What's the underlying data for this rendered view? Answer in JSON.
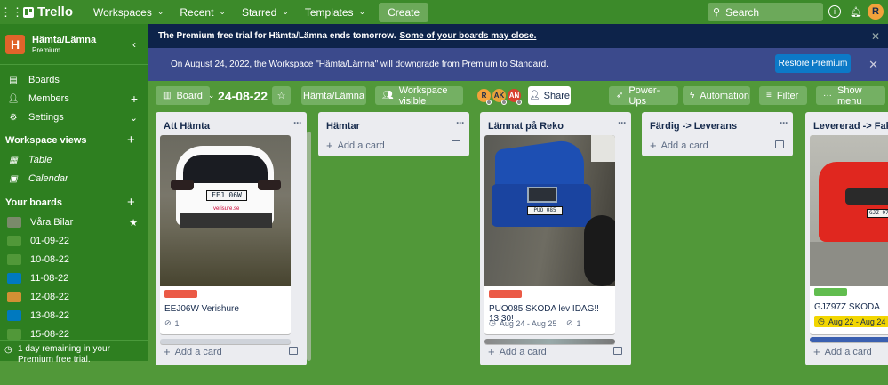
{
  "topbar": {
    "brand": "Trello",
    "menus": [
      "Workspaces",
      "Recent",
      "Starred",
      "Templates"
    ],
    "create_label": "Create",
    "search_placeholder": "Search",
    "avatar_initial": "R"
  },
  "sidebar": {
    "workspace_name": "Hämta/Lämna",
    "workspace_plan": "Premium",
    "workspace_initial": "H",
    "items": [
      "Boards",
      "Members",
      "Settings"
    ],
    "views_title": "Workspace views",
    "views": [
      "Table",
      "Calendar"
    ],
    "boards_title": "Your boards",
    "boards": [
      {
        "name": "Våra Bilar",
        "color": "#7a8a6a"
      },
      {
        "name": "01-09-22",
        "color": "#519839"
      },
      {
        "name": "10-08-22",
        "color": "#519839"
      },
      {
        "name": "11-08-22",
        "color": "#0079bf"
      },
      {
        "name": "12-08-22",
        "color": "#d29034"
      },
      {
        "name": "13-08-22",
        "color": "#0079bf"
      },
      {
        "name": "15-08-22",
        "color": "#519839"
      }
    ],
    "footer": "1 day remaining in your Premium free trial."
  },
  "banner1": {
    "text": "The Premium free trial for Hämta/Lämna ends tomorrow.",
    "link": "Some of your boards may close."
  },
  "banner2": {
    "text": "On August 24, 2022, the Workspace \"Hämta/Lämna\" will downgrade from Premium to Standard.",
    "button": "Restore Premium"
  },
  "board_header": {
    "view_label": "Board",
    "title": "24-08-22",
    "workspace_button": "Hämta/Lämna",
    "visibility_button": "Workspace visible",
    "members": [
      "R",
      "AK",
      "AN"
    ],
    "share": "Share",
    "powerups": "Power-Ups",
    "automation": "Automation",
    "filter": "Filter",
    "show_menu": "Show menu"
  },
  "lists": [
    {
      "title": "Att Hämta",
      "add_card": "Add a card",
      "card": {
        "title": "EEJ06W Verishure",
        "plate": "EEJ 06W",
        "watermark": "verisure.se",
        "label_color": "#eb5a46",
        "attachments": "1"
      }
    },
    {
      "title": "Hämtar",
      "add_card": "Add a card"
    },
    {
      "title": "Lämnat på Reko",
      "add_card": "Add a card",
      "card": {
        "title": "PUO085 SKODA lev IDAG!! 13.30!",
        "plate": "PUO 085",
        "label_color": "#eb5a46",
        "dates": "Aug 24 - Aug 25",
        "attachments": "1"
      }
    },
    {
      "title": "Färdig -> Leverans",
      "add_card": "Add a card"
    },
    {
      "title": "Levererad -> Faktura",
      "add_card": "Add a card",
      "card": {
        "title": "GJZ97Z SKODA",
        "plate": "GJZ 97Z",
        "label_color": "#61bd4f",
        "dates": "Aug 22 - Aug 24"
      }
    }
  ]
}
